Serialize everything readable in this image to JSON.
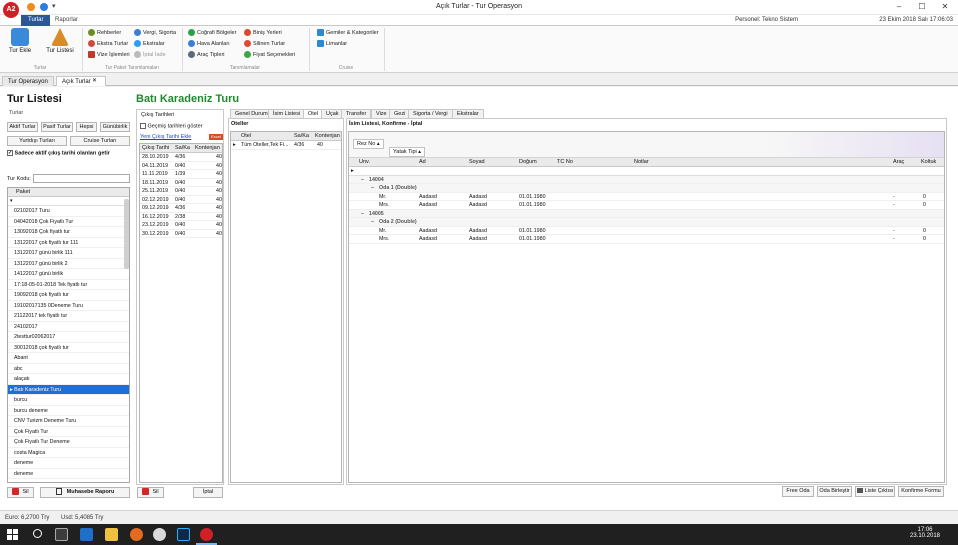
{
  "window": {
    "title": "Açık Turlar - Tur Operasyon",
    "logo": "A2"
  },
  "ribbon_tabs": [
    "Turlar",
    "Raporlar"
  ],
  "personel": "Personel: Tekno Sistem",
  "datetime": "23 Ekim 2018 Salı 17:06:03",
  "ribbon": {
    "turlar": {
      "tur_ekle": "Tur Ekle",
      "tur_listesi": "Tur Listesi",
      "caption": "Turlar"
    },
    "tanim": {
      "items": [
        "Rehberler",
        "Ekstra Turlar",
        "Vize İşlemleri",
        "Vergi, Sigorta",
        "Ekstralar",
        "İptal İade"
      ],
      "caption": "Tur Paket Tanımlamaları"
    },
    "tanimlamalar": {
      "items": [
        "Coğrafi Bölgeler",
        "Hava Alanları",
        "Araç Tipleri",
        "Biniş Yerleri",
        "Silinen Turlar",
        "Fiyat Seçenekleri"
      ],
      "caption": "Tanımlamalar"
    },
    "cruise": {
      "items": [
        "Gemiler & Kategoriler",
        "Limanlar"
      ],
      "caption": "Cruise"
    }
  },
  "doc_tabs": [
    "Tur Operasyon",
    "Açık Turlar"
  ],
  "left": {
    "title": "Tur Listesi",
    "group": "Turlar",
    "buttons": [
      "Aktif Turlar",
      "Pasif Turlar",
      "Hepsi",
      "Günübirlik",
      "Yurtdışı Turları",
      "Cruise Turları"
    ],
    "check": "Sadece aktif çıkış tarihi olanları getir",
    "tur_kodu": "Tur Kodu:",
    "col": "Paket",
    "rows": [
      "02102017 Turu",
      "04042018 Çok Fiyatlı Tur",
      "13092018 Çok fiyatlı tur",
      "13122017 çok fiyatlı tur 111",
      "13122017 günü birlik 111",
      "13122017 günü birlik 2",
      "14122017 günü birlik",
      "17:18-05-01-2018 Tek fiyatlı tur",
      "19092018 çok fiyatlı tur",
      "19102017135 0Deneme Turu",
      "21122017 tek fiyatlı tur",
      "24102017",
      "2testtur02062017",
      "30012018 çok fiyatlı tur",
      "Abant",
      "abc",
      "alaçatı",
      "Batı Karadeniz Turu",
      "burcu",
      "burcu deneme",
      "CNV Turizm Deneme Turu",
      "Çok Fiyatlı Tur",
      "Çok Fiyatlı Tur Deneme",
      "costa Magica",
      "deneme",
      "deneme"
    ],
    "selected": 17,
    "sil": "Sil",
    "rapor": "Muhasebe Raporu"
  },
  "tour_title": "Batı Karadeniz Turu",
  "dates": {
    "group": "Çıkış Tarihleri",
    "check": "Geçmiş tarihleri göster",
    "new_link": "Yeni Çıkış Tarihi Ekle",
    "new_badge": "Excel",
    "cols": [
      "Çıkış Tarihi",
      "Sa/Ka",
      "Kontenjan"
    ],
    "rows": [
      [
        "28.10.2019",
        "4/36",
        "40"
      ],
      [
        "04.11.2019",
        "0/40",
        "40"
      ],
      [
        "11.11.2019",
        "1/39",
        "40"
      ],
      [
        "18.11.2019",
        "0/40",
        "40"
      ],
      [
        "25.11.2019",
        "0/40",
        "40"
      ],
      [
        "02.12.2019",
        "0/40",
        "40"
      ],
      [
        "09.12.2019",
        "4/36",
        "40"
      ],
      [
        "16.12.2019",
        "2/38",
        "40"
      ],
      [
        "23.12.2019",
        "0/40",
        "40"
      ],
      [
        "30.12.2019",
        "0/40",
        "40"
      ]
    ],
    "sil": "Sil",
    "iptal": "İptal"
  },
  "tabs": [
    "Genel Durum",
    "İsim Listesi",
    "Otel",
    "Uçak",
    "Transfer",
    "Vize",
    "Gezi",
    "Sigorta / Vergi",
    "Ekstralar"
  ],
  "active_tab": 2,
  "otel": {
    "title": "Oteller",
    "cols": [
      "Otel",
      "Sa/Ka",
      "Kontenjan"
    ],
    "rows": [
      [
        "Tüm Oteller,Tek Fi...",
        "4/36",
        "40"
      ]
    ]
  },
  "isim": {
    "title": "İsim Listesi, Konfirme - İptal",
    "rez_no": "Rez No",
    "yatak": "Yatak Tipi",
    "cols": [
      "Unv.",
      "Ad",
      "Soyad",
      "Doğum",
      "TC No",
      "Notlar",
      "Araç",
      "Koltuk"
    ],
    "groups": [
      {
        "rez": "14004",
        "oda": "Oda 1 (Double)",
        "rows": [
          [
            "Mr.",
            "Aadasd",
            "Aadasd",
            "01.01.1980",
            "",
            "",
            "-",
            "0"
          ],
          [
            "Mrs.",
            "Aadasd",
            "Aadasd",
            "01.01.1980",
            "",
            "",
            "-",
            "0"
          ]
        ]
      },
      {
        "rez": "14005",
        "oda": "Oda 2 (Double)",
        "rows": [
          [
            "Mr.",
            "Aadasd",
            "Aadasd",
            "01.01.1980",
            "",
            "",
            "-",
            "0"
          ],
          [
            "Mrs.",
            "Aadasd",
            "Aadasd",
            "01.01.1980",
            "",
            "",
            "-",
            "0"
          ]
        ]
      }
    ]
  },
  "footer_buttons": [
    "Free Oda",
    "Oda Birleştir",
    "Liste Çıktısı",
    "Konfirme Formu"
  ],
  "status": {
    "euro": "Euro: 6,2700 Try",
    "usd": "Usd: 5,4085 Try"
  },
  "taskbar": {
    "time": "17:06",
    "date": "23.10.2018"
  }
}
